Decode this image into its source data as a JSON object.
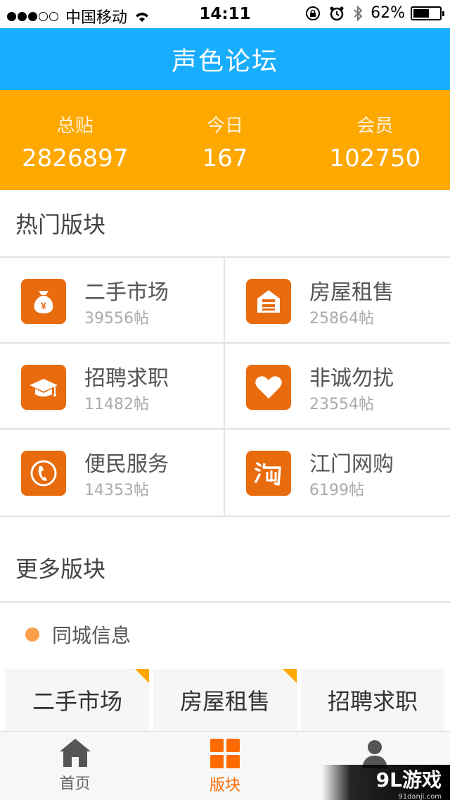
{
  "status_bar": {
    "carrier": "中国移动",
    "time": "14:11",
    "battery": "62%",
    "battery_level": 0.62
  },
  "header": {
    "title": "声色论坛"
  },
  "stats": [
    {
      "label": "总贴",
      "value": "2826897"
    },
    {
      "label": "今日",
      "value": "167"
    },
    {
      "label": "会员",
      "value": "102750"
    }
  ],
  "hot": {
    "title": "热门版块",
    "items": [
      {
        "name": "二手市场",
        "count": "39556帖",
        "icon": "money-bag-icon"
      },
      {
        "name": "房屋租售",
        "count": "25864帖",
        "icon": "house-icon"
      },
      {
        "name": "招聘求职",
        "count": "11482帖",
        "icon": "graduation-cap-icon"
      },
      {
        "name": "非诚勿扰",
        "count": "23554帖",
        "icon": "heart-icon"
      },
      {
        "name": "便民服务",
        "count": "14353帖",
        "icon": "phone-icon"
      },
      {
        "name": "江门网购",
        "count": "6199帖",
        "icon": "taobao-icon"
      }
    ]
  },
  "more": {
    "title": "更多版块",
    "category": "同城信息",
    "tiles": [
      "二手市场",
      "房屋租售",
      "招聘求职"
    ]
  },
  "tabs": [
    {
      "label": "首页",
      "icon": "home-icon"
    },
    {
      "label": "版块",
      "icon": "grid-icon",
      "active": true
    },
    {
      "label": "",
      "icon": "user-icon"
    }
  ],
  "colors": {
    "header": "#19adfd",
    "stats": "#fea800",
    "icon_bg": "#e86b0d",
    "active_tab": "#ff6a00"
  },
  "watermark": {
    "logo": "9L游戏",
    "site": "91danji.com"
  }
}
